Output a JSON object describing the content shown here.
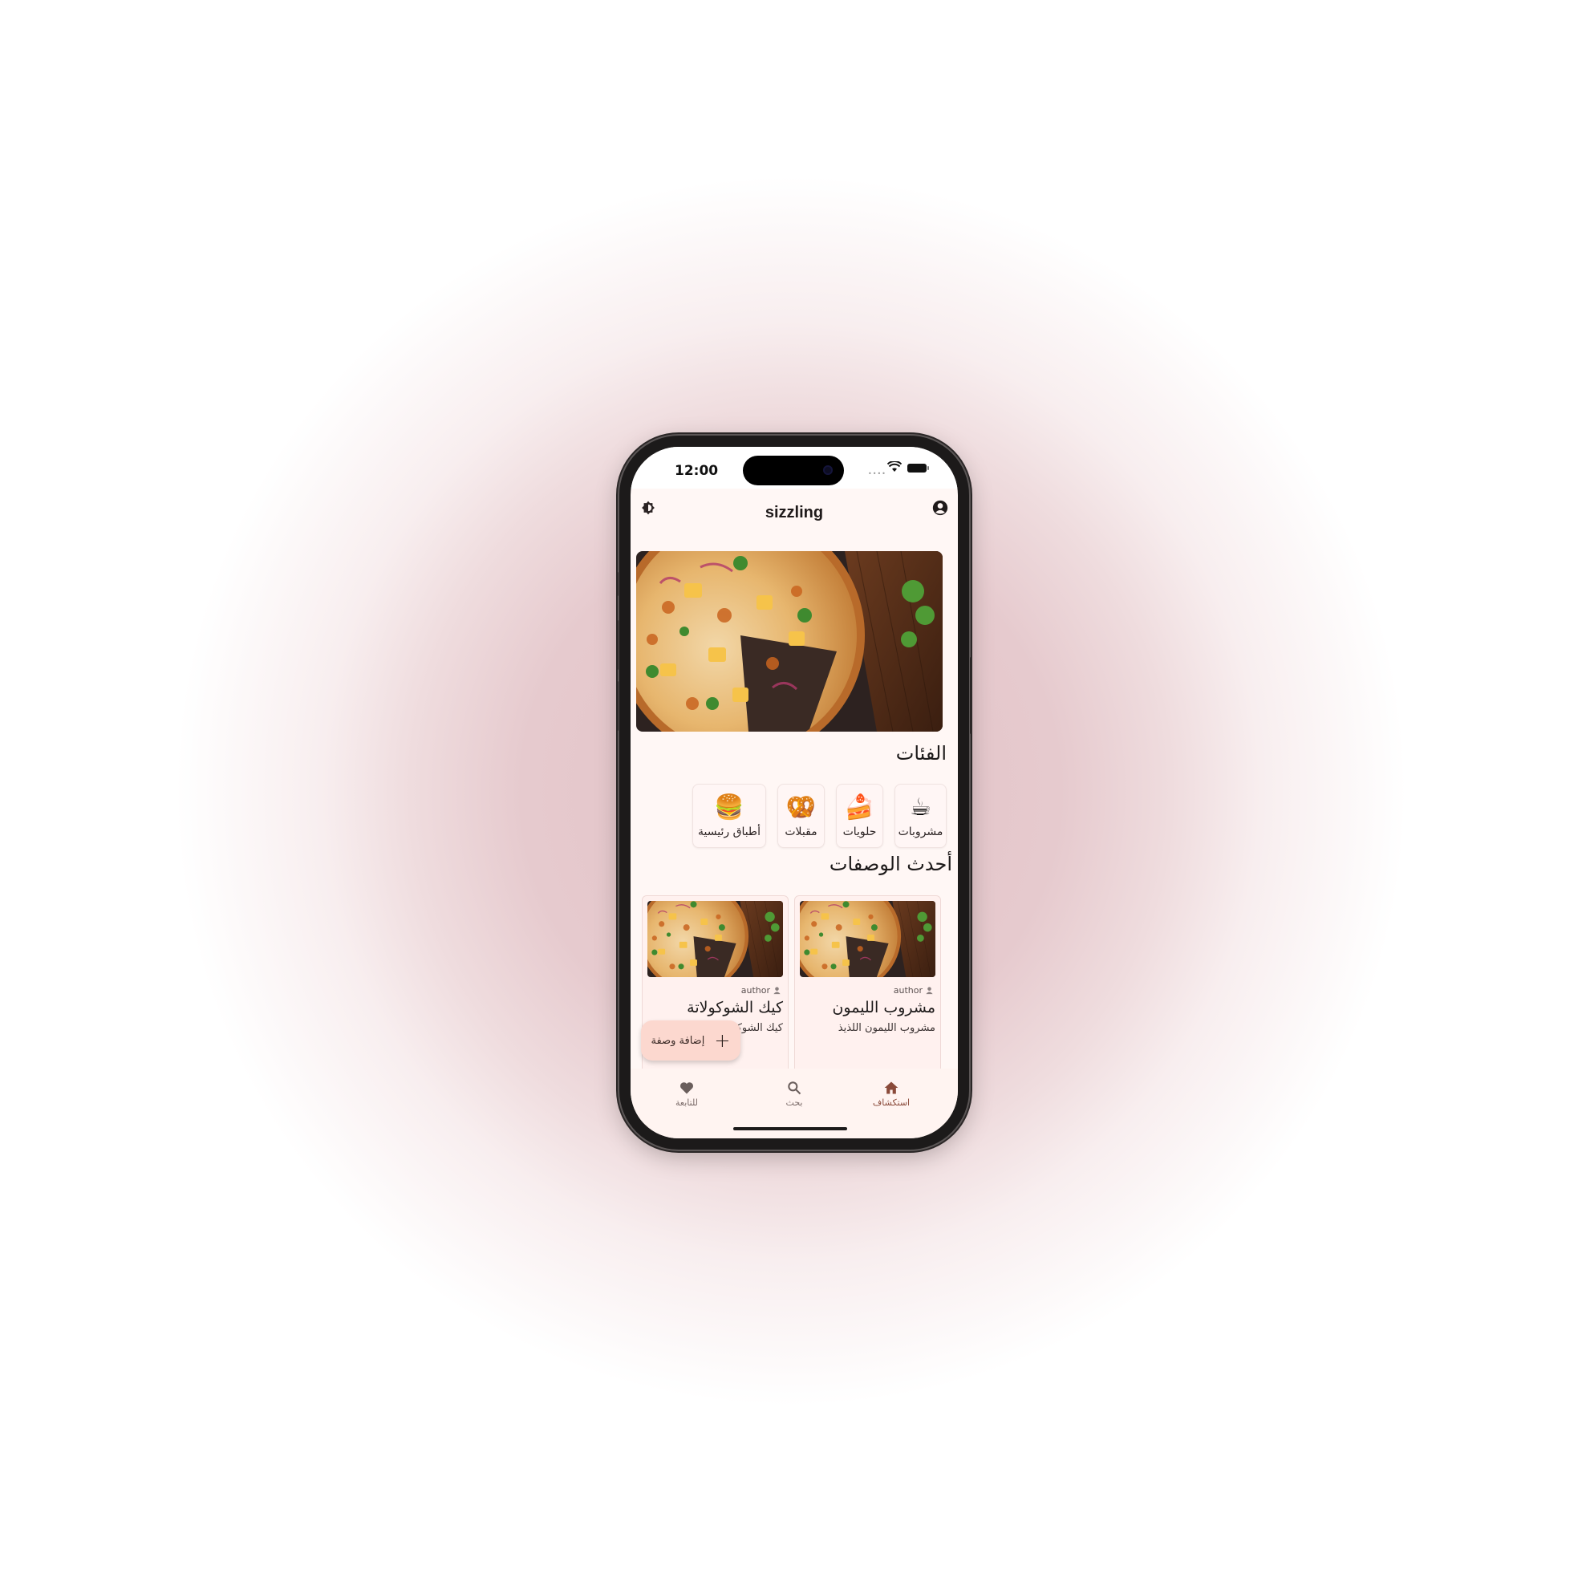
{
  "status_bar": {
    "time": "12:00"
  },
  "app": {
    "title": "sizzling"
  },
  "categories_section": {
    "title": "الفئات",
    "items": [
      {
        "label": "مشروبات",
        "icon": "coffee-cup-icon",
        "emoji": "☕"
      },
      {
        "label": "حلويات",
        "icon": "cake-slice-icon",
        "emoji": "🍰"
      },
      {
        "label": "مقبلات",
        "icon": "pretzel-icon",
        "emoji": "🥨"
      },
      {
        "label": "أطباق رئيسية",
        "icon": "burger-icon",
        "emoji": "🍔"
      }
    ]
  },
  "recent_section": {
    "title": "أحدث الوصفات",
    "recipes": [
      {
        "author": "author",
        "title": "مشروب الليمون",
        "description": "مشروب الليمون اللذيذ"
      },
      {
        "author": "author",
        "title": "كيك الشوكولاتة",
        "description": "كيك الشوكولاتة"
      }
    ]
  },
  "fab": {
    "label": "إضافة وصفة"
  },
  "bottom_nav": {
    "items": [
      {
        "label": "استكشاف",
        "icon": "home-icon",
        "active": true
      },
      {
        "label": "بحث",
        "icon": "search-icon",
        "active": false
      },
      {
        "label": "للتابعة",
        "icon": "heart-icon",
        "active": false
      }
    ]
  },
  "colors": {
    "background": "#fff7f5",
    "accent": "#8a4a3a",
    "fab": "#fcd8cf",
    "card": "#fff1ef"
  }
}
